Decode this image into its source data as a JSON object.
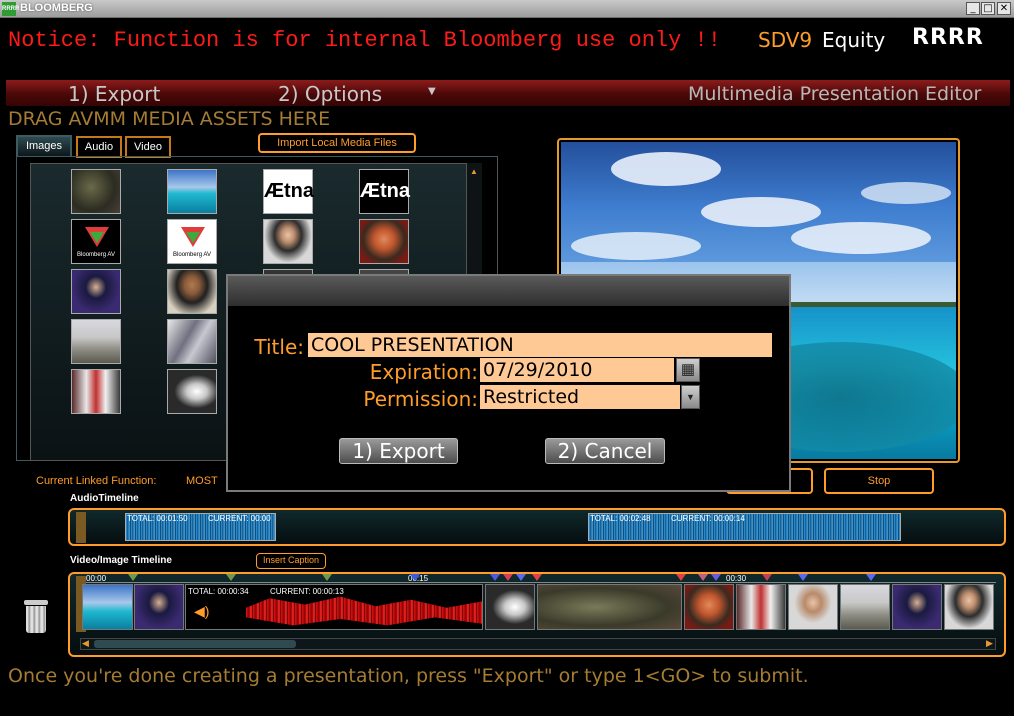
{
  "window": {
    "title": "BLOOMBERG",
    "icon_text": "RRRR",
    "minimize": "_",
    "maximize": "□",
    "close": "✕"
  },
  "notice": "Notice: Function is for internal Bloomberg use only !!",
  "security": {
    "ticker": "SDV9",
    "market": "Equity",
    "user": "RRRR"
  },
  "menu": {
    "export": "1) Export",
    "options": "2) Options",
    "editor_title": "Multimedia Presentation Editor"
  },
  "drag_label": "DRAG AVMM MEDIA ASSETS HERE",
  "tabs": {
    "images": "Images",
    "audio": "Audio",
    "video": "Video"
  },
  "import_button": "Import Local Media Files",
  "thumbs": {
    "aetna": "Ætna",
    "bloomberg_av": "Bloomberg AV"
  },
  "linked_function": {
    "label": "Current Linked Function:",
    "value": "MOST"
  },
  "stop_button": "Stop",
  "audio_timeline": {
    "label": "AudioTimeline",
    "clips": [
      {
        "total": "TOTAL: 00:01:50",
        "current": "CURRENT: 00:00"
      },
      {
        "total": "TOTAL: 00:02:48",
        "current": "CURRENT: 00:00:14"
      }
    ]
  },
  "video_timeline": {
    "label": "Video/Image Timeline",
    "insert_caption": "Insert Caption",
    "ticks": [
      "00:00",
      "00:15",
      "00:30"
    ],
    "audio_clip": {
      "total": "TOTAL: 00:00:34",
      "current": "CURRENT: 00:00:13"
    }
  },
  "dialog": {
    "title_label": "Title:",
    "title_value": "COOL PRESENTATION",
    "expiration_label": "Expiration:",
    "expiration_value": "07/29/2010",
    "permission_label": "Permission:",
    "permission_value": "Restricted",
    "export_button": "1)  Export",
    "cancel_button": "2)  Cancel"
  },
  "footer": "Once you're done creating a presentation, press \"Export\" or type 1<GO> to submit.",
  "colors": {
    "orange": "#ff9c2a",
    "notice_red": "#ff1a1a",
    "field_bg": "#ffc996",
    "menu_red": "#8d1b1b"
  }
}
